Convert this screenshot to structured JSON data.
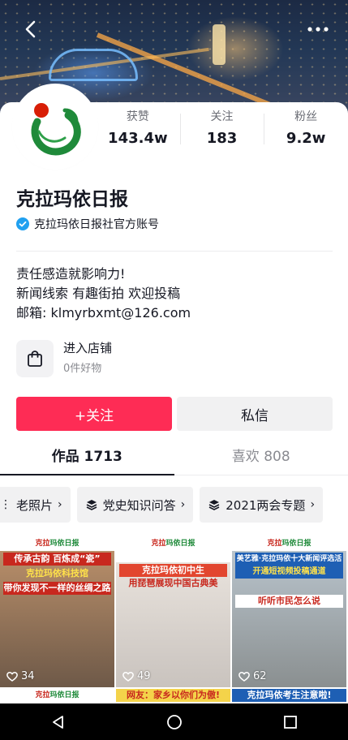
{
  "header": {
    "back_icon": "chevron-left-icon",
    "more_icon": "more-dots-icon"
  },
  "profile": {
    "name": "克拉玛依日报",
    "verified_text": "克拉玛依日报社官方账号",
    "bio_lines": [
      "责任感造就影响力!",
      "新闻线索 有趣街拍 欢迎投稿",
      "邮箱: klmyrbxmt@126.com"
    ],
    "stats": [
      {
        "label": "获赞",
        "value": "143.4w"
      },
      {
        "label": "关注",
        "value": "183"
      },
      {
        "label": "粉丝",
        "value": "9.2w"
      }
    ],
    "shop_title": "进入店铺",
    "shop_sub": "0件好物"
  },
  "actions": {
    "follow_label": "+关注",
    "message_label": "私信"
  },
  "tabs": [
    {
      "label": "作品 1713",
      "active": true
    },
    {
      "label": "喜欢 808",
      "active": false
    }
  ],
  "chips": [
    {
      "label": "老照片"
    },
    {
      "label": "党史知识问答"
    },
    {
      "label": "2021两会专题"
    }
  ],
  "videos": [
    {
      "line1": "传承古韵 百炼成“瓷”",
      "line2": "克拉玛依科技馆",
      "line3": "带你发现不一样的丝绸之路",
      "likes": "34"
    },
    {
      "line1": "克拉玛依初中生",
      "line2": "用琵琶展现中国古典美",
      "line3": "",
      "likes": "49"
    },
    {
      "line1": "美艺雅·克拉玛依十大新闻评选活动",
      "line2": "开通短视频投稿通道",
      "line3": "听听市民怎么说",
      "likes": "62"
    }
  ],
  "thumb_brand": {
    "red": "克拉",
    "green": "玛依日报"
  },
  "row2_texts": [
    "",
    "网友：家乡以你们为傲!",
    "克拉玛依考生注意啦!"
  ],
  "colors": {
    "accent": "#fe2c55",
    "verify_blue": "#20a0f0",
    "logo_green": "#1f8a3a",
    "logo_red": "#d81e06"
  }
}
